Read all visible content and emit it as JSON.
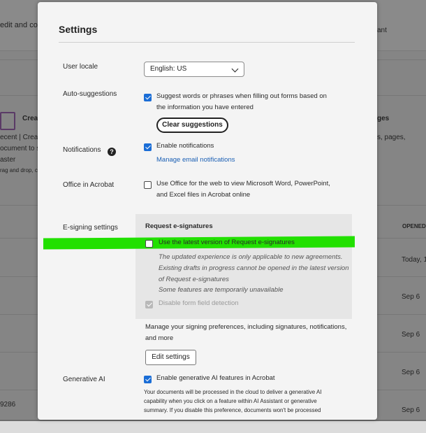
{
  "background": {
    "top_left_text": "edit and co",
    "top_right_text": "ant",
    "create_label": "Crea",
    "recent_text": "ecent | Crea",
    "doc_text": "ocument to s",
    "aster_text": "aster",
    "drag_text": "rag and drop, c",
    "right_ges": "ges",
    "right_pages": "s, pages,",
    "opened_header": "OPENED",
    "opened_values": [
      "Today, 1",
      "Sep 6",
      "Sep 6",
      "Sep 6",
      "Sep 6"
    ],
    "left_number": "9286"
  },
  "dialog": {
    "title": "Settings",
    "user_locale": {
      "label": "User locale",
      "value": "English: US"
    },
    "auto_suggestions": {
      "label": "Auto-suggestions",
      "checkbox_text_line1": "Suggest words or phrases when filling out forms based on",
      "checkbox_text_line2": "the information you have entered",
      "checked": true,
      "clear_button": "Clear suggestions"
    },
    "notifications": {
      "label": "Notifications",
      "help": "?",
      "checkbox_text": "Enable notifications",
      "checked": true,
      "manage_link": "Manage email notifications"
    },
    "office": {
      "label": "Office in Acrobat",
      "checkbox_text_line1": "Use Office for the web to view Microsoft Word, PowerPoint,",
      "checkbox_text_line2": "and Excel files in Acrobat online",
      "checked": false
    },
    "esigning": {
      "label": "E-signing settings",
      "section_title": "Request e-signatures",
      "latest_version_text": "Use the latest version of Request e-signatures",
      "latest_checked": false,
      "info_line1": "The updated experience is only applicable to new agreements.",
      "info_line2": "Existing drafts in progress cannot be opened in the latest version",
      "info_line3": "of Request e-signatures",
      "unavailable_link": "Some features are temporarily unavailable",
      "disable_detection_text": "Disable form field detection",
      "disable_detection_checked": true,
      "manage_line1": "Manage your signing preferences, including signatures, notifications,",
      "manage_line2": "and more",
      "edit_button": "Edit settings"
    },
    "generative_ai": {
      "label": "Generative AI",
      "checkbox_text": "Enable generative AI features in Acrobat",
      "checked": true,
      "desc_line1": "Your documents will be processed in the cloud to deliver a generative AI",
      "desc_line2": "capability when you click on a feature within AI Assistant or generative",
      "desc_line3": "summary. If you disable this preference, documents won't be processed"
    }
  },
  "colors": {
    "accent": "#1a6dd6",
    "link": "#1a5fb4",
    "highlight": "#22e000"
  }
}
